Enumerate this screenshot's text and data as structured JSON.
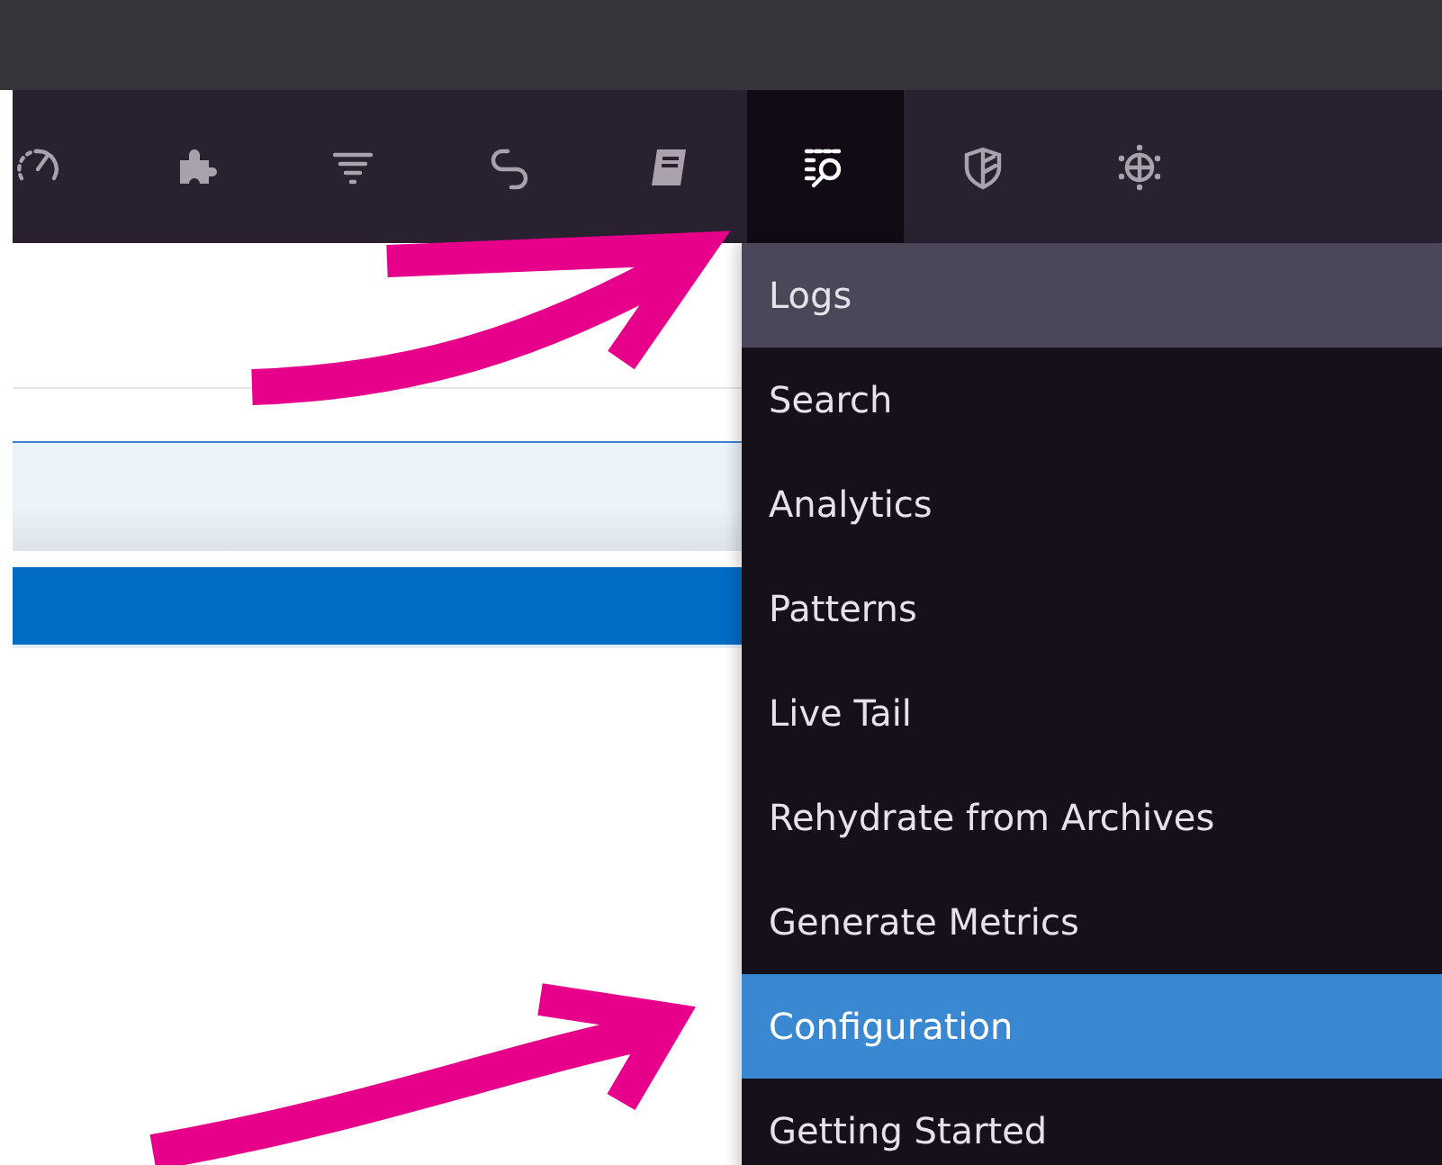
{
  "nav_icons": [
    {
      "selected": false
    },
    {
      "selected": false
    },
    {
      "selected": false
    },
    {
      "selected": false
    },
    {
      "selected": false
    },
    {
      "selected": true
    },
    {
      "selected": false
    },
    {
      "selected": false
    }
  ],
  "menu": {
    "items": [
      {
        "label": "Logs",
        "kind": "header",
        "selected": false
      },
      {
        "label": "Search",
        "kind": "item",
        "selected": false
      },
      {
        "label": "Analytics",
        "kind": "item",
        "selected": false
      },
      {
        "label": "Patterns",
        "kind": "item",
        "selected": false
      },
      {
        "label": "Live Tail",
        "kind": "item",
        "selected": false
      },
      {
        "label": "Rehydrate from Archives",
        "kind": "item",
        "selected": false
      },
      {
        "label": "Generate Metrics",
        "kind": "item",
        "selected": false
      },
      {
        "label": "Configuration",
        "kind": "item",
        "selected": true
      },
      {
        "label": "Getting Started",
        "kind": "item",
        "selected": false
      }
    ]
  }
}
